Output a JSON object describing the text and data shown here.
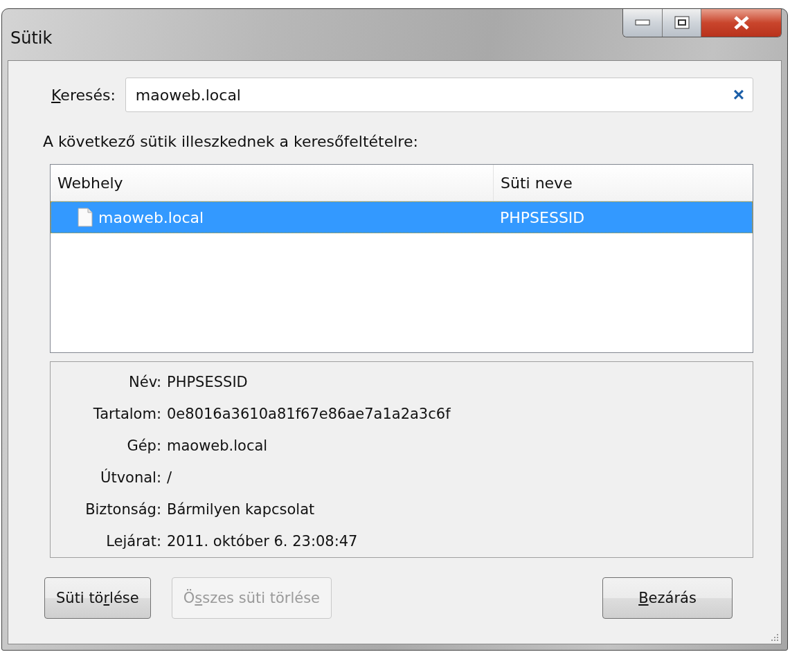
{
  "window": {
    "title": "Sütik"
  },
  "search": {
    "label": {
      "key": "K",
      "after": "eresés:"
    },
    "value": "maoweb.local",
    "clear": "×"
  },
  "intro": "A következő sütik illeszkednek a keresőfeltételre:",
  "table": {
    "columns": [
      "Webhely",
      "Süti neve"
    ],
    "rows": [
      {
        "site": "maoweb.local",
        "name": "PHPSESSID",
        "selected": true
      }
    ]
  },
  "details": [
    {
      "label": "Név:",
      "value": "PHPSESSID"
    },
    {
      "label": "Tartalom:",
      "value": "0e8016a3610a81f67e86ae7a1a2a3c6f"
    },
    {
      "label": "Gép:",
      "value": "maoweb.local"
    },
    {
      "label": "Útvonal:",
      "value": "/"
    },
    {
      "label": "Biztonság:",
      "value": "Bármilyen kapcsolat"
    },
    {
      "label": "Lejárat:",
      "value": "2011. október 6. 23:08:47"
    }
  ],
  "buttons": [
    {
      "before": "Süti tö",
      "key": "r",
      "after": "lése",
      "disabled": false,
      "kind": "left"
    },
    {
      "before": "Ö",
      "key": "s",
      "after": "szes süti törlése",
      "disabled": true,
      "kind": "left"
    },
    {
      "key": "B",
      "after": "ezárás",
      "disabled": false,
      "kind": "right"
    }
  ]
}
